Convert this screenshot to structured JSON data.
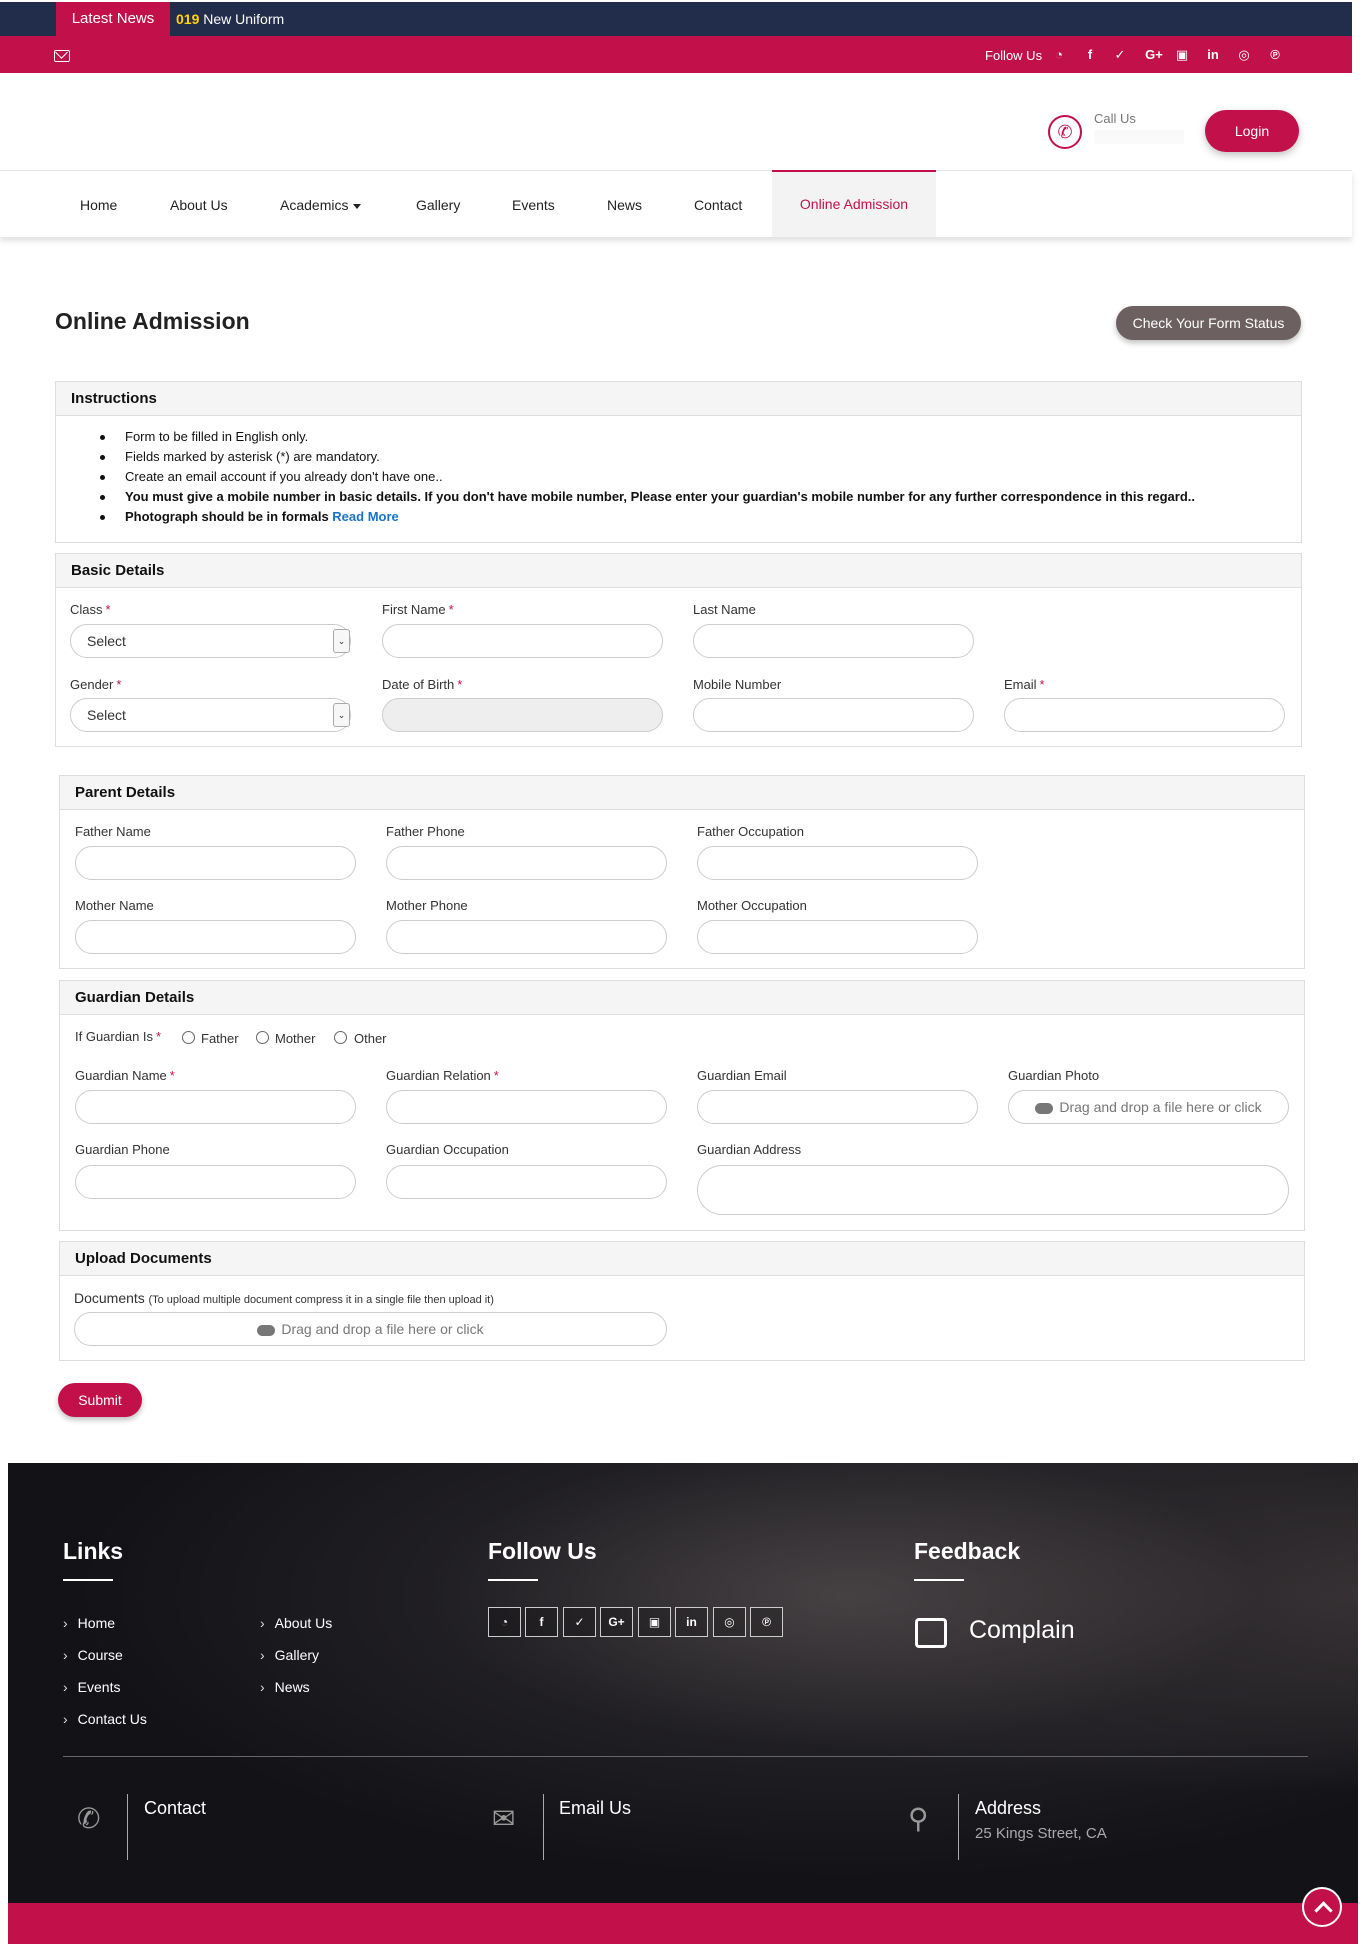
{
  "topbar": {
    "news_label": "Latest News",
    "ticker_year": "019",
    "ticker_text": "New Uniform",
    "follow_label": "Follow Us"
  },
  "header": {
    "call_label": "Call Us",
    "login_label": "Login"
  },
  "nav": {
    "items": [
      "Home",
      "About Us",
      "Academics",
      "Gallery",
      "Events",
      "News",
      "Contact"
    ],
    "active": "Online Admission"
  },
  "page": {
    "title": "Online Admission",
    "status_button": "Check Your Form Status"
  },
  "instructions": {
    "title": "Instructions",
    "items": [
      "Form to be filled in English only.",
      "Fields marked by asterisk (*) are mandatory.",
      "Create an email account if you already don't have one..",
      "You must give a mobile number in basic details. If you don't have mobile number, Please enter your guardian's mobile number for any further correspondence in this regard..",
      "Photograph should be in formals"
    ],
    "read_more": "Read More"
  },
  "basic": {
    "title": "Basic Details",
    "class_label": "Class",
    "class_value": "Select",
    "first_name_label": "First Name",
    "last_name_label": "Last Name",
    "gender_label": "Gender",
    "gender_value": "Select",
    "dob_label": "Date of Birth",
    "mobile_label": "Mobile Number",
    "email_label": "Email"
  },
  "parent": {
    "title": "Parent Details",
    "father_name": "Father Name",
    "father_phone": "Father Phone",
    "father_occupation": "Father Occupation",
    "mother_name": "Mother Name",
    "mother_phone": "Mother Phone",
    "mother_occupation": "Mother Occupation"
  },
  "guardian": {
    "title": "Guardian Details",
    "if_label": "If Guardian Is",
    "options": [
      "Father",
      "Mother",
      "Other"
    ],
    "name": "Guardian Name",
    "relation": "Guardian Relation",
    "email": "Guardian Email",
    "photo": "Guardian Photo",
    "photo_drop": "Drag and drop a file here or click",
    "phone": "Guardian Phone",
    "occupation": "Guardian Occupation",
    "address": "Guardian Address"
  },
  "upload": {
    "title": "Upload Documents",
    "doc_label": "Documents",
    "doc_hint": "(To upload multiple document compress it in a single file then upload it)",
    "drop": "Drag and drop a file here or click"
  },
  "submit_label": "Submit",
  "footer": {
    "links_title": "Links",
    "links_col1": [
      "Home",
      "Course",
      "Events",
      "Contact Us"
    ],
    "links_col2": [
      "About Us",
      "Gallery",
      "News"
    ],
    "follow_title": "Follow Us",
    "social": [
      "whatsapp-icon",
      "facebook-icon",
      "twitter-icon",
      "google-plus-icon",
      "youtube-icon",
      "linkedin-icon",
      "instagram-icon",
      "pinterest-icon"
    ],
    "feedback_title": "Feedback",
    "complain": "Complain",
    "contact_title": "Contact",
    "email_title": "Email Us",
    "address_title": "Address",
    "address_value": "25 Kings Street, CA"
  },
  "colors": {
    "brand": "#c2114a",
    "navy": "#222c4b",
    "footer": "#131317"
  }
}
